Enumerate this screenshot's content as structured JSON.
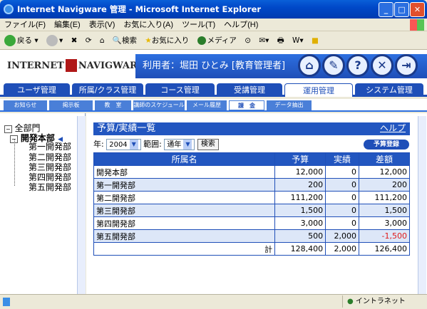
{
  "window": {
    "title": "Internet Navigware 管理 - Microsoft Internet Explorer"
  },
  "menu": [
    "ファイル(F)",
    "編集(E)",
    "表示(V)",
    "お気に入り(A)",
    "ツール(T)",
    "ヘルプ(H)"
  ],
  "toolbar": {
    "back": "戻る",
    "search": "検索",
    "favorites": "お気に入り",
    "media": "メディア"
  },
  "banner": {
    "logo_left": "Internet",
    "logo_right": "Navigware",
    "user_label": "利用者：堀田 ひとみ [教育管理者]"
  },
  "main_tabs": [
    "ユーザ管理",
    "所属/クラス管理",
    "コース管理",
    "受講管理",
    "運用管理",
    "システム管理"
  ],
  "sub_tabs": [
    "お知らせ",
    "掲示板",
    "教　室",
    "講師のスケジュール",
    "メール履歴",
    "課　金",
    "データ抽出"
  ],
  "tree": {
    "root": "全部門",
    "selected": "開発本部",
    "children": [
      "第一開発部",
      "第二開発部",
      "第三開発部",
      "第四開発部",
      "第五開発部"
    ]
  },
  "page": {
    "title": "予算/実績一覧",
    "help": "ヘルプ"
  },
  "filter": {
    "year_label": "年:",
    "year": "2004",
    "range_label": "範囲:",
    "range": "通年",
    "search": "検索"
  },
  "register_button": "予算登録",
  "table": {
    "headers": [
      "所属名",
      "予算",
      "実績",
      "差額"
    ],
    "rows": [
      [
        "開発本部",
        "12,000",
        "0",
        "12,000"
      ],
      [
        "第一開発部",
        "200",
        "0",
        "200"
      ],
      [
        "第二開発部",
        "111,200",
        "0",
        "111,200"
      ],
      [
        "第三開発部",
        "1,500",
        "0",
        "1,500"
      ],
      [
        "第四開発部",
        "3,000",
        "0",
        "3,000"
      ],
      [
        "第五開発部",
        "500",
        "2,000",
        "-1,500"
      ]
    ],
    "total": [
      "計",
      "128,400",
      "2,000",
      "126,400"
    ]
  },
  "status": {
    "zone": "イントラネット"
  }
}
